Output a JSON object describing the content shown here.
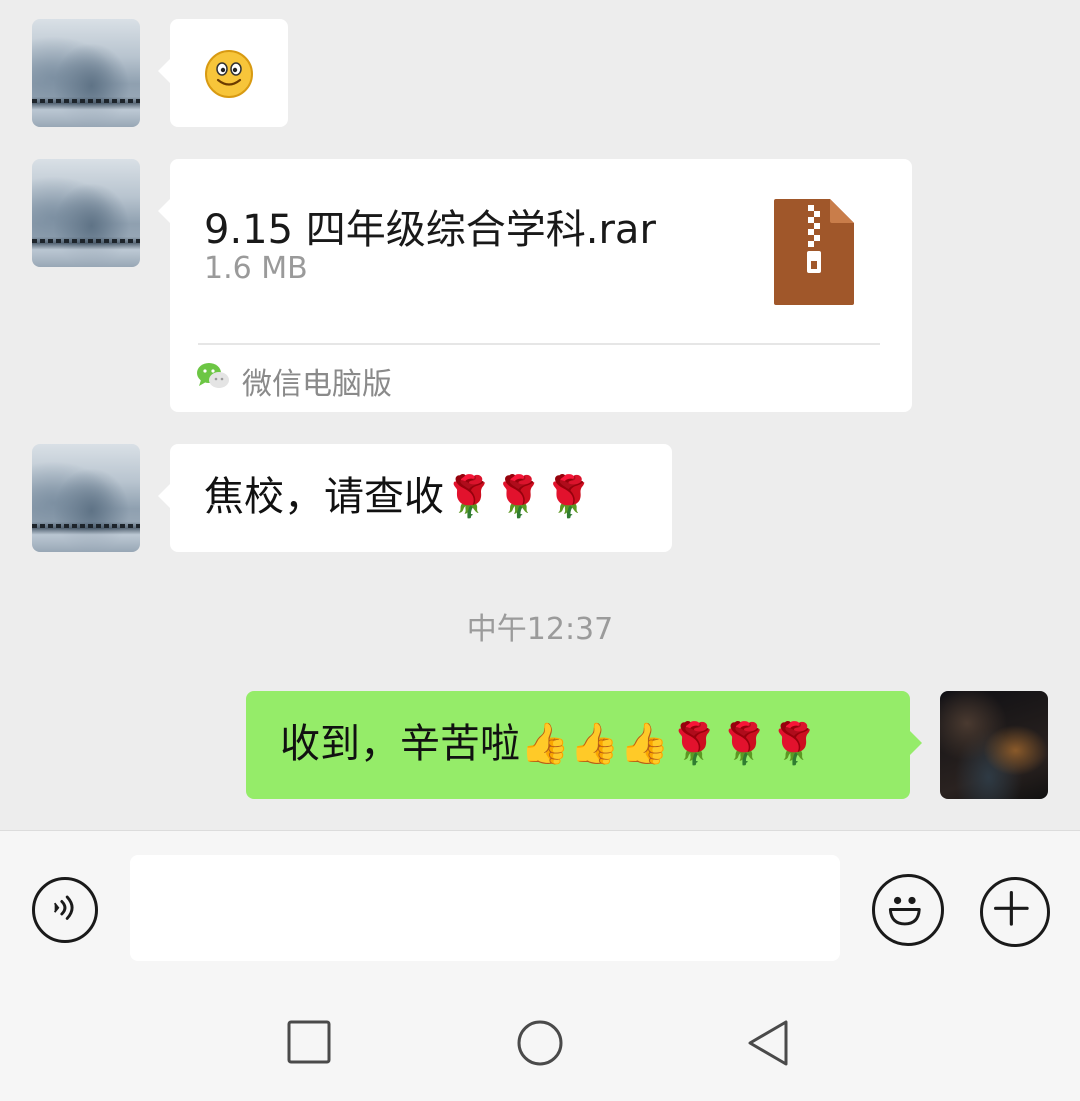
{
  "messages": {
    "m1": {
      "emoji": "smile"
    },
    "m2": {
      "file_name": "9.15 四年级综合学科.rar",
      "file_size": "1.6 MB",
      "source": "微信电脑版",
      "icon": "zip-archive-icon"
    },
    "m3": {
      "text": "焦校，请查收🌹🌹🌹"
    },
    "m4": {
      "text": "收到，辛苦啦👍👍👍🌹🌹🌹"
    }
  },
  "timestamp": "中午12:37",
  "input": {
    "value": "",
    "placeholder": ""
  },
  "icons": {
    "voice": "voice-icon",
    "emoji": "emoji-icon",
    "plus": "plus-icon",
    "nav_square": "recent-apps-icon",
    "nav_circle": "home-icon",
    "nav_back": "back-icon"
  },
  "colors": {
    "chat_bg": "#ededed",
    "sent_bubble": "#95ec69",
    "received_bubble": "#ffffff",
    "archive_brown": "#a0572a"
  }
}
